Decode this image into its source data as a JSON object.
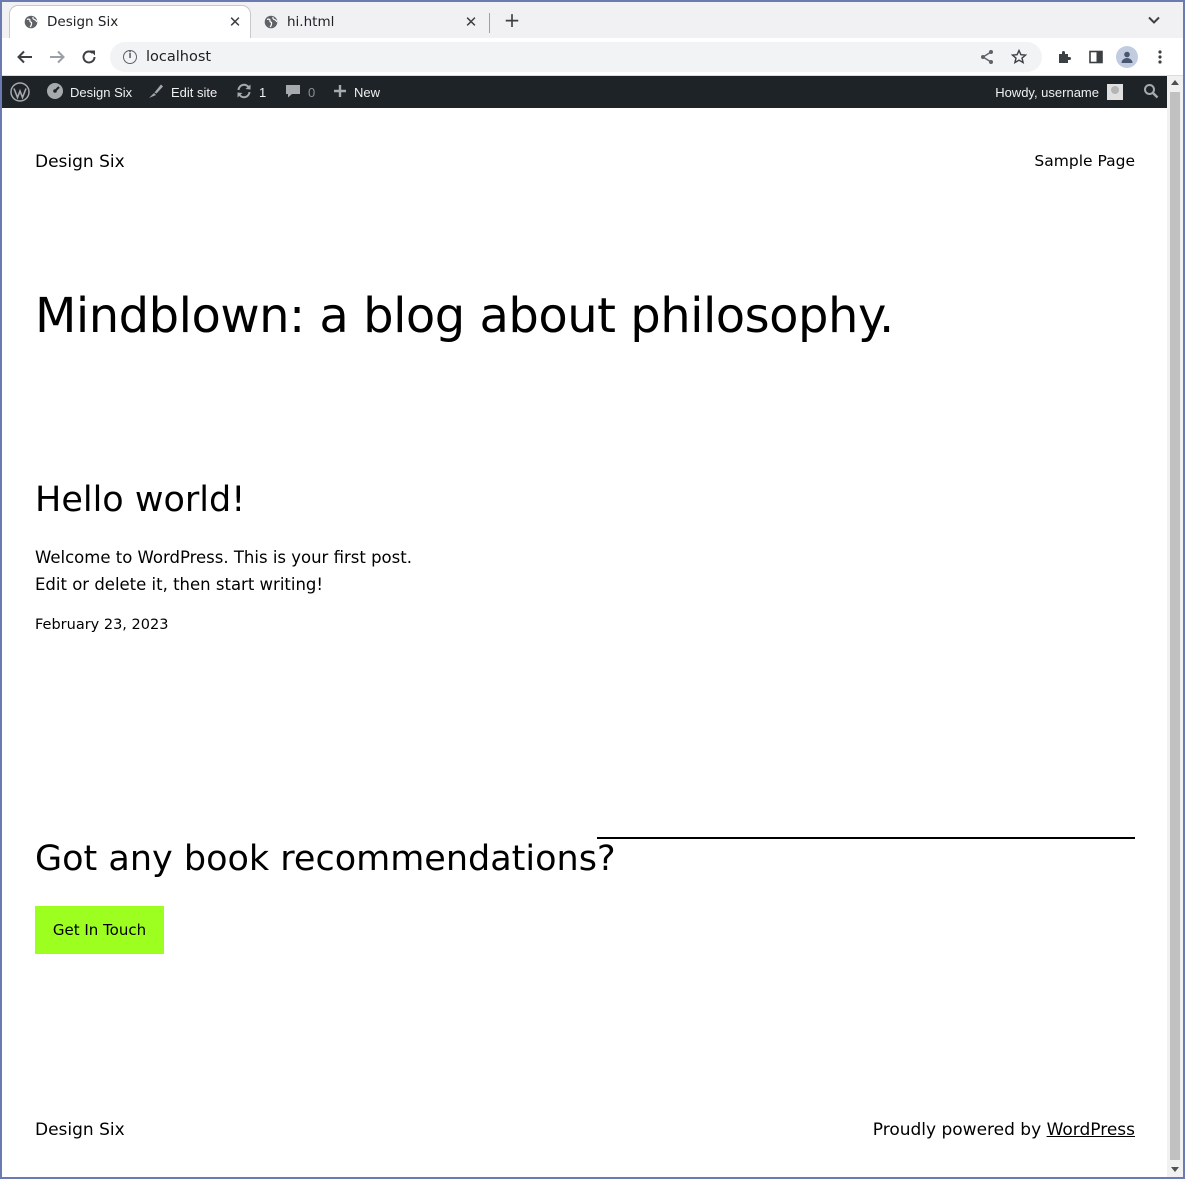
{
  "browser": {
    "tabs": [
      {
        "title": "Design Six",
        "active": true
      },
      {
        "title": "hi.html",
        "active": false
      }
    ],
    "url": "localhost"
  },
  "adminbar": {
    "site_name": "Design Six",
    "edit_site": "Edit site",
    "updates_count": "1",
    "comments_count": "0",
    "new_label": "New",
    "greeting": "Howdy, username"
  },
  "site": {
    "title": "Design Six",
    "nav": [
      "Sample Page"
    ],
    "hero": "Mindblown: a blog about philosophy."
  },
  "post": {
    "title": "Hello world!",
    "excerpt": "Welcome to WordPress. This is your first post. Edit or delete it, then start writing!",
    "date": "February 23, 2023"
  },
  "cta": {
    "heading": "Got any book recommendations?",
    "button": "Get In Touch",
    "button_color": "#9cff1f"
  },
  "footer": {
    "title": "Design Six",
    "powered_prefix": "Proudly powered by ",
    "powered_link": "WordPress"
  }
}
